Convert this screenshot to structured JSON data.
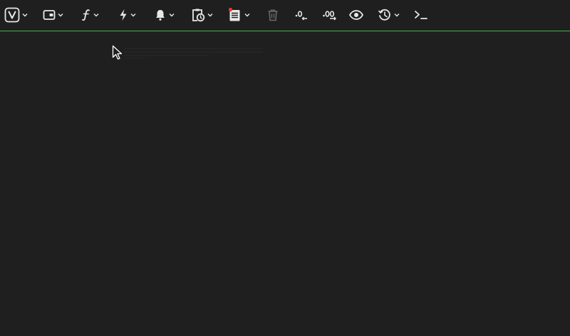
{
  "toolbar": {
    "accent_color": "#4caf50",
    "background": "#1f1f1f",
    "items": [
      {
        "icon": "vue-logo-icon",
        "has_dropdown": true
      },
      {
        "icon": "wallet-icon",
        "has_dropdown": true
      },
      {
        "icon": "function-icon",
        "has_dropdown": true
      },
      {
        "icon": "lightning-icon",
        "has_dropdown": true
      },
      {
        "icon": "bell-icon",
        "has_dropdown": true
      },
      {
        "icon": "clipboard-clock-icon",
        "has_dropdown": true
      },
      {
        "icon": "notes-icon",
        "has_dropdown": true,
        "badge_color": "#e53935"
      },
      {
        "icon": "trash-icon",
        "has_dropdown": false,
        "disabled": true
      },
      {
        "icon": "decrease-decimal-icon",
        "has_dropdown": false,
        "text": ".0"
      },
      {
        "icon": "increase-decimal-icon",
        "has_dropdown": false,
        "text": ".00"
      },
      {
        "icon": "eye-icon",
        "has_dropdown": false
      },
      {
        "icon": "history-icon",
        "has_dropdown": true
      },
      {
        "icon": "terminal-icon",
        "has_dropdown": false
      }
    ]
  }
}
